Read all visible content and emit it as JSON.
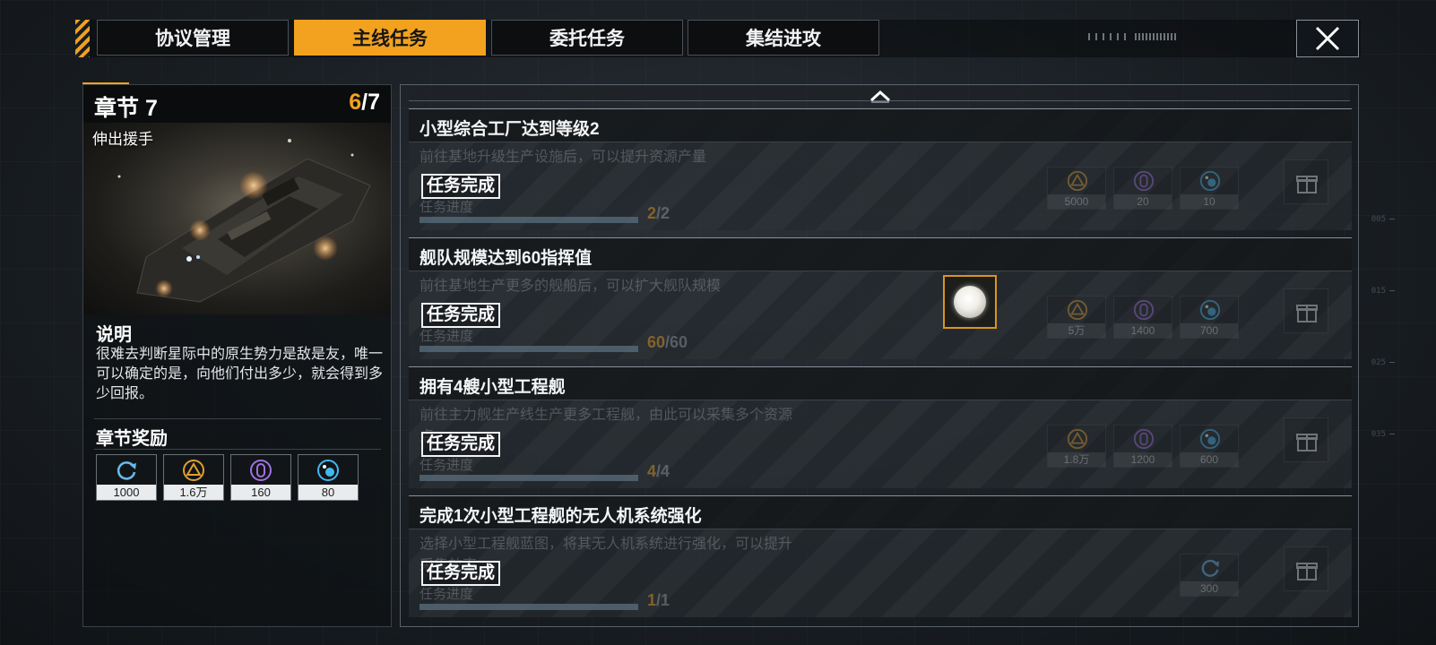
{
  "tabs": [
    {
      "label": "协议管理",
      "active": false
    },
    {
      "label": "主线任务",
      "active": true
    },
    {
      "label": "委托任务",
      "active": false
    },
    {
      "label": "集结进攻",
      "active": false
    }
  ],
  "close_icon": "close-icon",
  "chapter": {
    "title": "章节 7",
    "progress_current": "6",
    "progress_total": "/7",
    "subtitle": "伸出援手",
    "desc_label": "说明",
    "description": "很难去判断星际中的原生势力是敌是友，唯一可以确定的是，向他们付出多少，就会得到多少回报。",
    "rewards_label": "章节奖励",
    "rewards": [
      {
        "icon": "refresh-icon",
        "value": "1000"
      },
      {
        "icon": "triangle-resource-icon",
        "value": "1.6万"
      },
      {
        "icon": "crystal-resource-icon",
        "value": "160"
      },
      {
        "icon": "sphere-resource-icon",
        "value": "80"
      }
    ]
  },
  "missions": [
    {
      "title": "小型综合工厂达到等级2",
      "description": "前往基地升级生产设施后，可以提升资源产量",
      "status": "任务完成",
      "progress_label": "任务进度",
      "progress_current": "2",
      "progress_total": "/2",
      "progress_fraction": 1.0,
      "rewards": [
        {
          "icon": "triangle-resource-icon",
          "value": "5000"
        },
        {
          "icon": "crystal-resource-icon",
          "value": "20"
        },
        {
          "icon": "sphere-resource-icon",
          "value": "10"
        }
      ]
    },
    {
      "title": "舰队规模达到60指挥值",
      "description": "前往基地生产更多的舰船后，可以扩大舰队规模",
      "status": "任务完成",
      "progress_label": "任务进度",
      "progress_current": "60",
      "progress_total": "/60",
      "progress_fraction": 1.0,
      "rewards": [
        {
          "icon": "triangle-resource-icon",
          "value": "5万"
        },
        {
          "icon": "crystal-resource-icon",
          "value": "1400"
        },
        {
          "icon": "sphere-resource-icon",
          "value": "700"
        }
      ]
    },
    {
      "title": "拥有4艘小型工程舰",
      "description": "前往主力舰生产线生产更多工程舰，由此可以采集多个资源点",
      "status": "任务完成",
      "progress_label": "任务进度",
      "progress_current": "4",
      "progress_total": "/4",
      "progress_fraction": 1.0,
      "rewards": [
        {
          "icon": "triangle-resource-icon",
          "value": "1.8万"
        },
        {
          "icon": "crystal-resource-icon",
          "value": "1200"
        },
        {
          "icon": "sphere-resource-icon",
          "value": "600"
        }
      ]
    },
    {
      "title": "完成1次小型工程舰的无人机系统强化",
      "description": "选择小型工程舰蓝图，将其无人机系统进行强化，可以提升采集效率",
      "status": "任务完成",
      "progress_label": "任务进度",
      "progress_current": "1",
      "progress_total": "/1",
      "progress_fraction": 1.0,
      "rewards": [
        {
          "icon": "refresh-icon",
          "value": "300"
        }
      ]
    }
  ],
  "colors": {
    "accent": "#f2a21e",
    "triangle_resource": "#e0a030",
    "crystal_resource": "#a070e0",
    "sphere_resource": "#40b8f0",
    "refresh": "#6ab8e8"
  }
}
